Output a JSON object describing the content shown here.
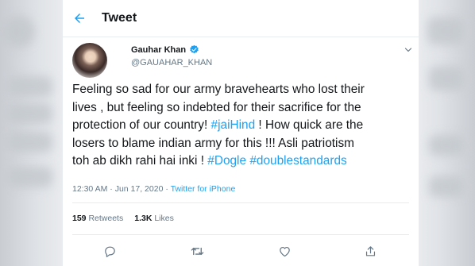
{
  "header": {
    "title": "Tweet"
  },
  "author": {
    "name": "Gauhar Khan",
    "handle": "@GAUAHAR_KHAN"
  },
  "tweet": {
    "line1": "Feeling so sad for our army bravehearts who lost their",
    "line2": "lives , but feeling so indebted for their sacrifice for the",
    "line3_a": "protection of our country! ",
    "hashtag_jaihind": "#jaiHind",
    "line3_b": " ! How quick are the",
    "line4": "losers to blame indian army for this !!! Asli patriotism",
    "line5_a": "toh ab dikh rahi hai inki ! ",
    "hashtag_dogle": "#Dogle",
    "line5_space": " ",
    "hashtag_double": "#doublestandards"
  },
  "meta": {
    "timestamp": "12:30 AM · Jun 17, 2020",
    "separator": " · ",
    "source": "Twitter for iPhone"
  },
  "stats": {
    "retweets_count": "159",
    "retweets_label": "Retweets",
    "likes_count": "1.3K",
    "likes_label": "Likes"
  },
  "colors": {
    "accent": "#1da1f2",
    "text": "#14171a",
    "muted": "#657786",
    "verified": "#1da1f2"
  },
  "icons": [
    "back-arrow-icon",
    "verified-badge-icon",
    "chevron-down-icon",
    "reply-icon",
    "retweet-icon",
    "like-icon",
    "share-icon"
  ]
}
